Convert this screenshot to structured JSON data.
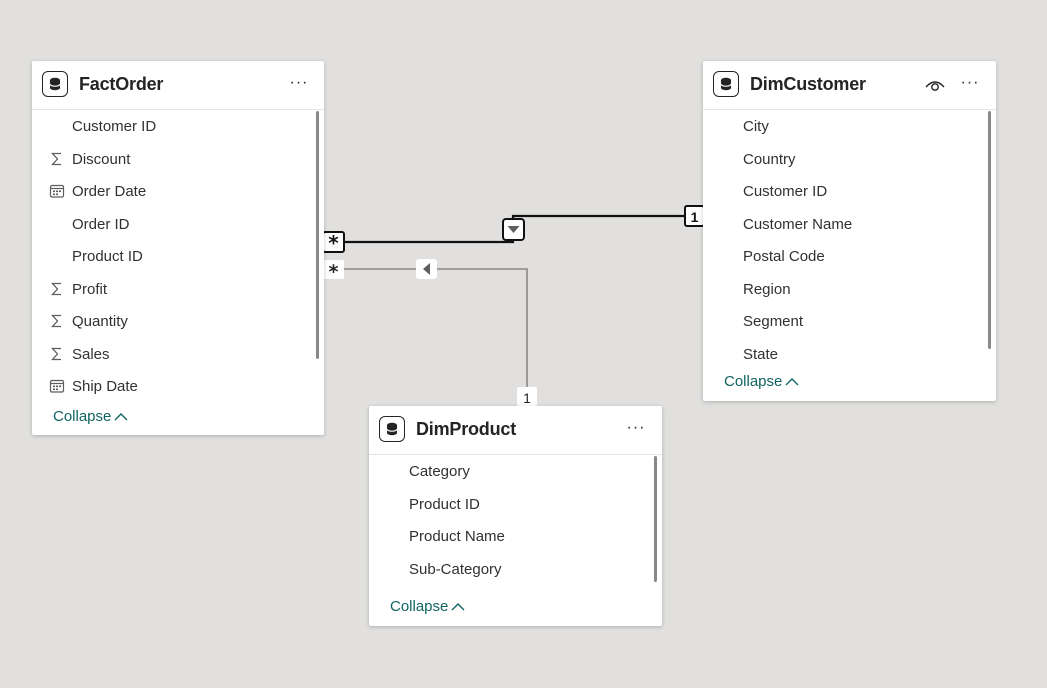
{
  "tables": {
    "factorder": {
      "title": "FactOrder",
      "fields": [
        {
          "label": "Customer ID",
          "icon": ""
        },
        {
          "label": "Discount",
          "icon": "sigma-icon"
        },
        {
          "label": "Order Date",
          "icon": "calendar-icon"
        },
        {
          "label": "Order ID",
          "icon": ""
        },
        {
          "label": "Product ID",
          "icon": ""
        },
        {
          "label": "Profit",
          "icon": "sigma-icon"
        },
        {
          "label": "Quantity",
          "icon": "sigma-icon"
        },
        {
          "label": "Sales",
          "icon": "sigma-icon"
        },
        {
          "label": "Ship Date",
          "icon": "calendar-icon"
        }
      ],
      "collapse_label": "Collapse"
    },
    "dimcustomer": {
      "title": "DimCustomer",
      "fields": [
        {
          "label": "City",
          "icon": ""
        },
        {
          "label": "Country",
          "icon": ""
        },
        {
          "label": "Customer ID",
          "icon": ""
        },
        {
          "label": "Customer Name",
          "icon": ""
        },
        {
          "label": "Postal Code",
          "icon": ""
        },
        {
          "label": "Region",
          "icon": ""
        },
        {
          "label": "Segment",
          "icon": ""
        },
        {
          "label": "State",
          "icon": ""
        }
      ],
      "collapse_label": "Collapse"
    },
    "dimproduct": {
      "title": "DimProduct",
      "fields": [
        {
          "label": "Category",
          "icon": ""
        },
        {
          "label": "Product ID",
          "icon": ""
        },
        {
          "label": "Product Name",
          "icon": ""
        },
        {
          "label": "Sub-Category",
          "icon": ""
        }
      ],
      "collapse_label": "Collapse"
    }
  },
  "relationships": {
    "customer": {
      "many_label": "*",
      "one_label": "1"
    },
    "product": {
      "many_label": "*",
      "one_label": "1"
    }
  },
  "more_glyph": "···",
  "collapse_chevron": "^",
  "colors": {
    "canvas": "#e1e0df",
    "accent": "#0f6461",
    "active_line": "#000000",
    "inactive_line": "#8a8886"
  }
}
